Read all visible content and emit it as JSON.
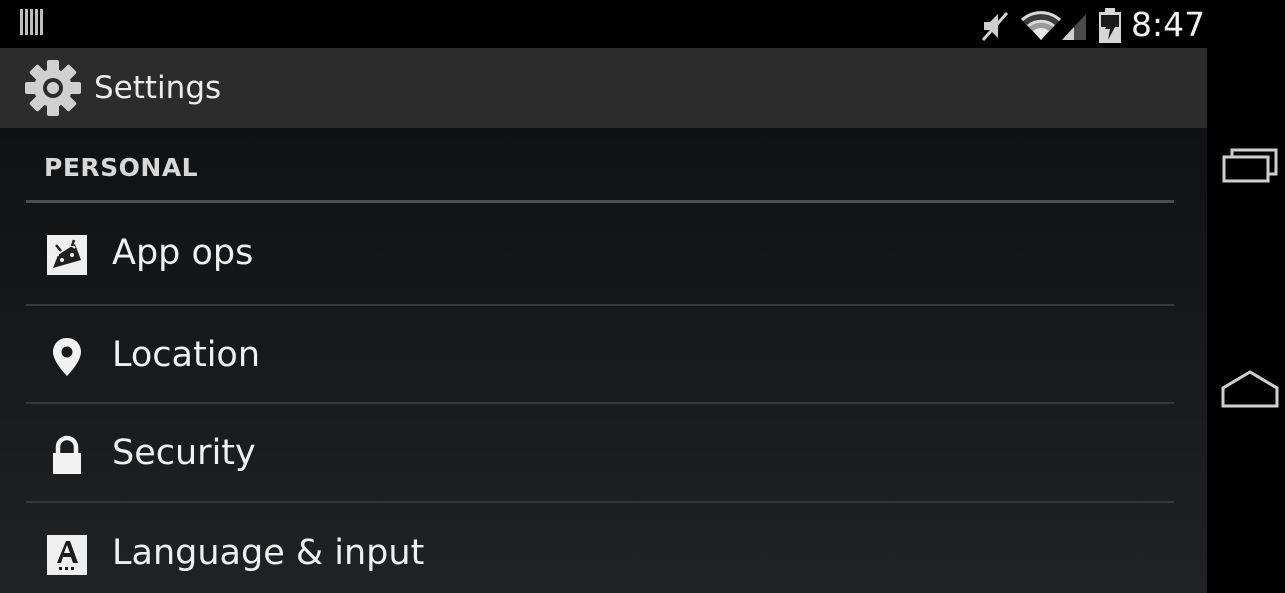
{
  "status_bar": {
    "time": "8:47",
    "icons": [
      "notification-icon",
      "mute-icon",
      "wifi-icon",
      "signal-icon",
      "battery-charging-icon"
    ]
  },
  "action_bar": {
    "title": "Settings",
    "icon": "settings-gear-icon"
  },
  "settings": {
    "section_header": "PERSONAL",
    "items": [
      {
        "label": "App ops",
        "icon": "app-ops-icon"
      },
      {
        "label": "Location",
        "icon": "location-pin-icon"
      },
      {
        "label": "Security",
        "icon": "lock-icon"
      },
      {
        "label": "Language & input",
        "icon": "language-icon"
      }
    ]
  },
  "nav_bar": {
    "buttons": [
      "recents-icon",
      "home-icon"
    ]
  },
  "colors": {
    "background": "#000000",
    "action_bar": "#2c2c2c",
    "content": "#15171a",
    "text": "#f0f0f0"
  }
}
